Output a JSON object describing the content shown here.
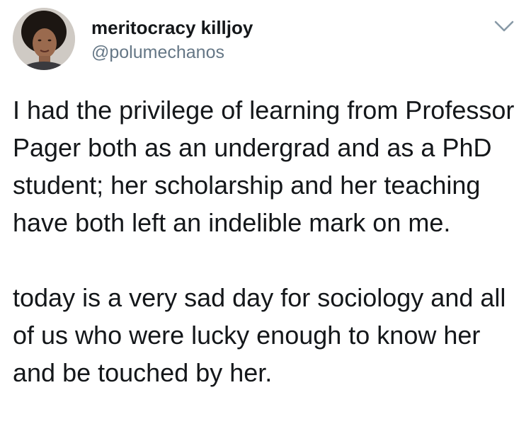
{
  "tweet": {
    "author": {
      "display_name": "meritocracy killjoy",
      "handle": "@polumechanos",
      "avatar_icon": "user-avatar-photo"
    },
    "menu_icon": "chevron-down-icon",
    "paragraphs": [
      "I had the privilege of learning from Professor Pager both as an undergrad and as a PhD student; her scholarship and her teaching have both left an indelible mark on me.",
      "today is a very sad day for sociology and all of us who were lucky enough to know her and be touched by her."
    ]
  },
  "colors": {
    "text": "#14171a",
    "secondary": "#657786",
    "background": "#ffffff"
  }
}
